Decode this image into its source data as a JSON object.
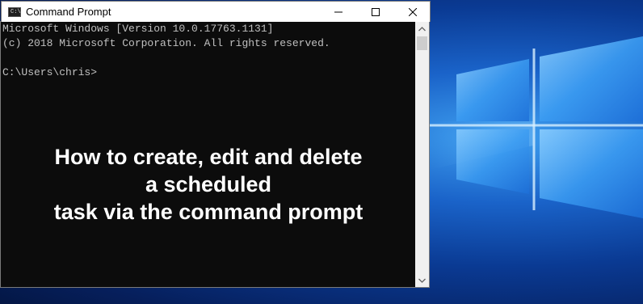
{
  "window": {
    "title": "Command Prompt",
    "app_icon_text": "C:\\",
    "controls": [
      "minimize",
      "maximize",
      "close"
    ]
  },
  "console": {
    "lines": [
      "Microsoft Windows [Version 10.0.17763.1131]",
      "(c) 2018 Microsoft Corporation. All rights reserved.",
      "",
      "C:\\Users\\chris>"
    ]
  },
  "overlay": {
    "lines": [
      "How to create, edit and delete",
      "a scheduled",
      "task via the command prompt"
    ]
  },
  "colors": {
    "console_bg": "#0c0c0c",
    "console_text": "#c0c0c0",
    "overlay_text": "#ffffff",
    "desktop_blue": "#1a63c9"
  }
}
